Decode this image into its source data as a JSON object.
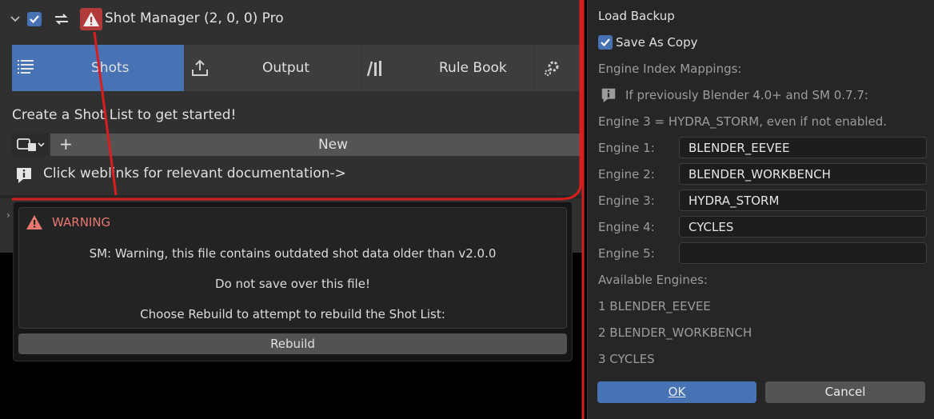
{
  "panel": {
    "title": "Shot Manager (2, 0, 0) Pro",
    "tabs": [
      {
        "label": "Shots",
        "icon": "shot-list-icon"
      },
      {
        "label": "Output",
        "icon": "upload-icon"
      },
      {
        "label": "Rule Book",
        "icon": "library-icon"
      },
      {
        "label": "",
        "icon": "gear-icon"
      }
    ],
    "create_text": "Create a Shot List to get started!",
    "new_label": "New",
    "plus_label": "+",
    "info_text": "Click weblinks for relevant documentation->"
  },
  "warning": {
    "title": "WARNING",
    "lines": [
      "SM: Warning, this file contains outdated shot data older than v2.0.0",
      "Do not save over this file!",
      "Choose Rebuild to attempt to rebuild the Shot List:"
    ],
    "rebuild_label": "Rebuild"
  },
  "dialog": {
    "load_backup": "Load Backup",
    "save_as_copy": "Save As Copy",
    "mappings_label": "Engine Index Mappings:",
    "info_line": "If previously Blender 4.0+ and SM 0.7.7:",
    "engine3_note": "Engine 3 = HYDRA_STORM, even if not enabled.",
    "engines": [
      {
        "label": "Engine 1:",
        "value": "BLENDER_EEVEE"
      },
      {
        "label": "Engine 2:",
        "value": "BLENDER_WORKBENCH"
      },
      {
        "label": "Engine 3:",
        "value": "HYDRA_STORM"
      },
      {
        "label": "Engine 4:",
        "value": "CYCLES"
      },
      {
        "label": "Engine 5:",
        "value": ""
      }
    ],
    "available_label": "Available Engines:",
    "available": [
      "1 BLENDER_EEVEE",
      "2 BLENDER_WORKBENCH",
      "3 CYCLES"
    ],
    "ok_label": "OK",
    "cancel_label": "Cancel"
  },
  "colors": {
    "accent": "#4772b3",
    "warning_red": "#b23a3a",
    "warning_text": "#e8786f",
    "annotation": "#d91e1e"
  }
}
